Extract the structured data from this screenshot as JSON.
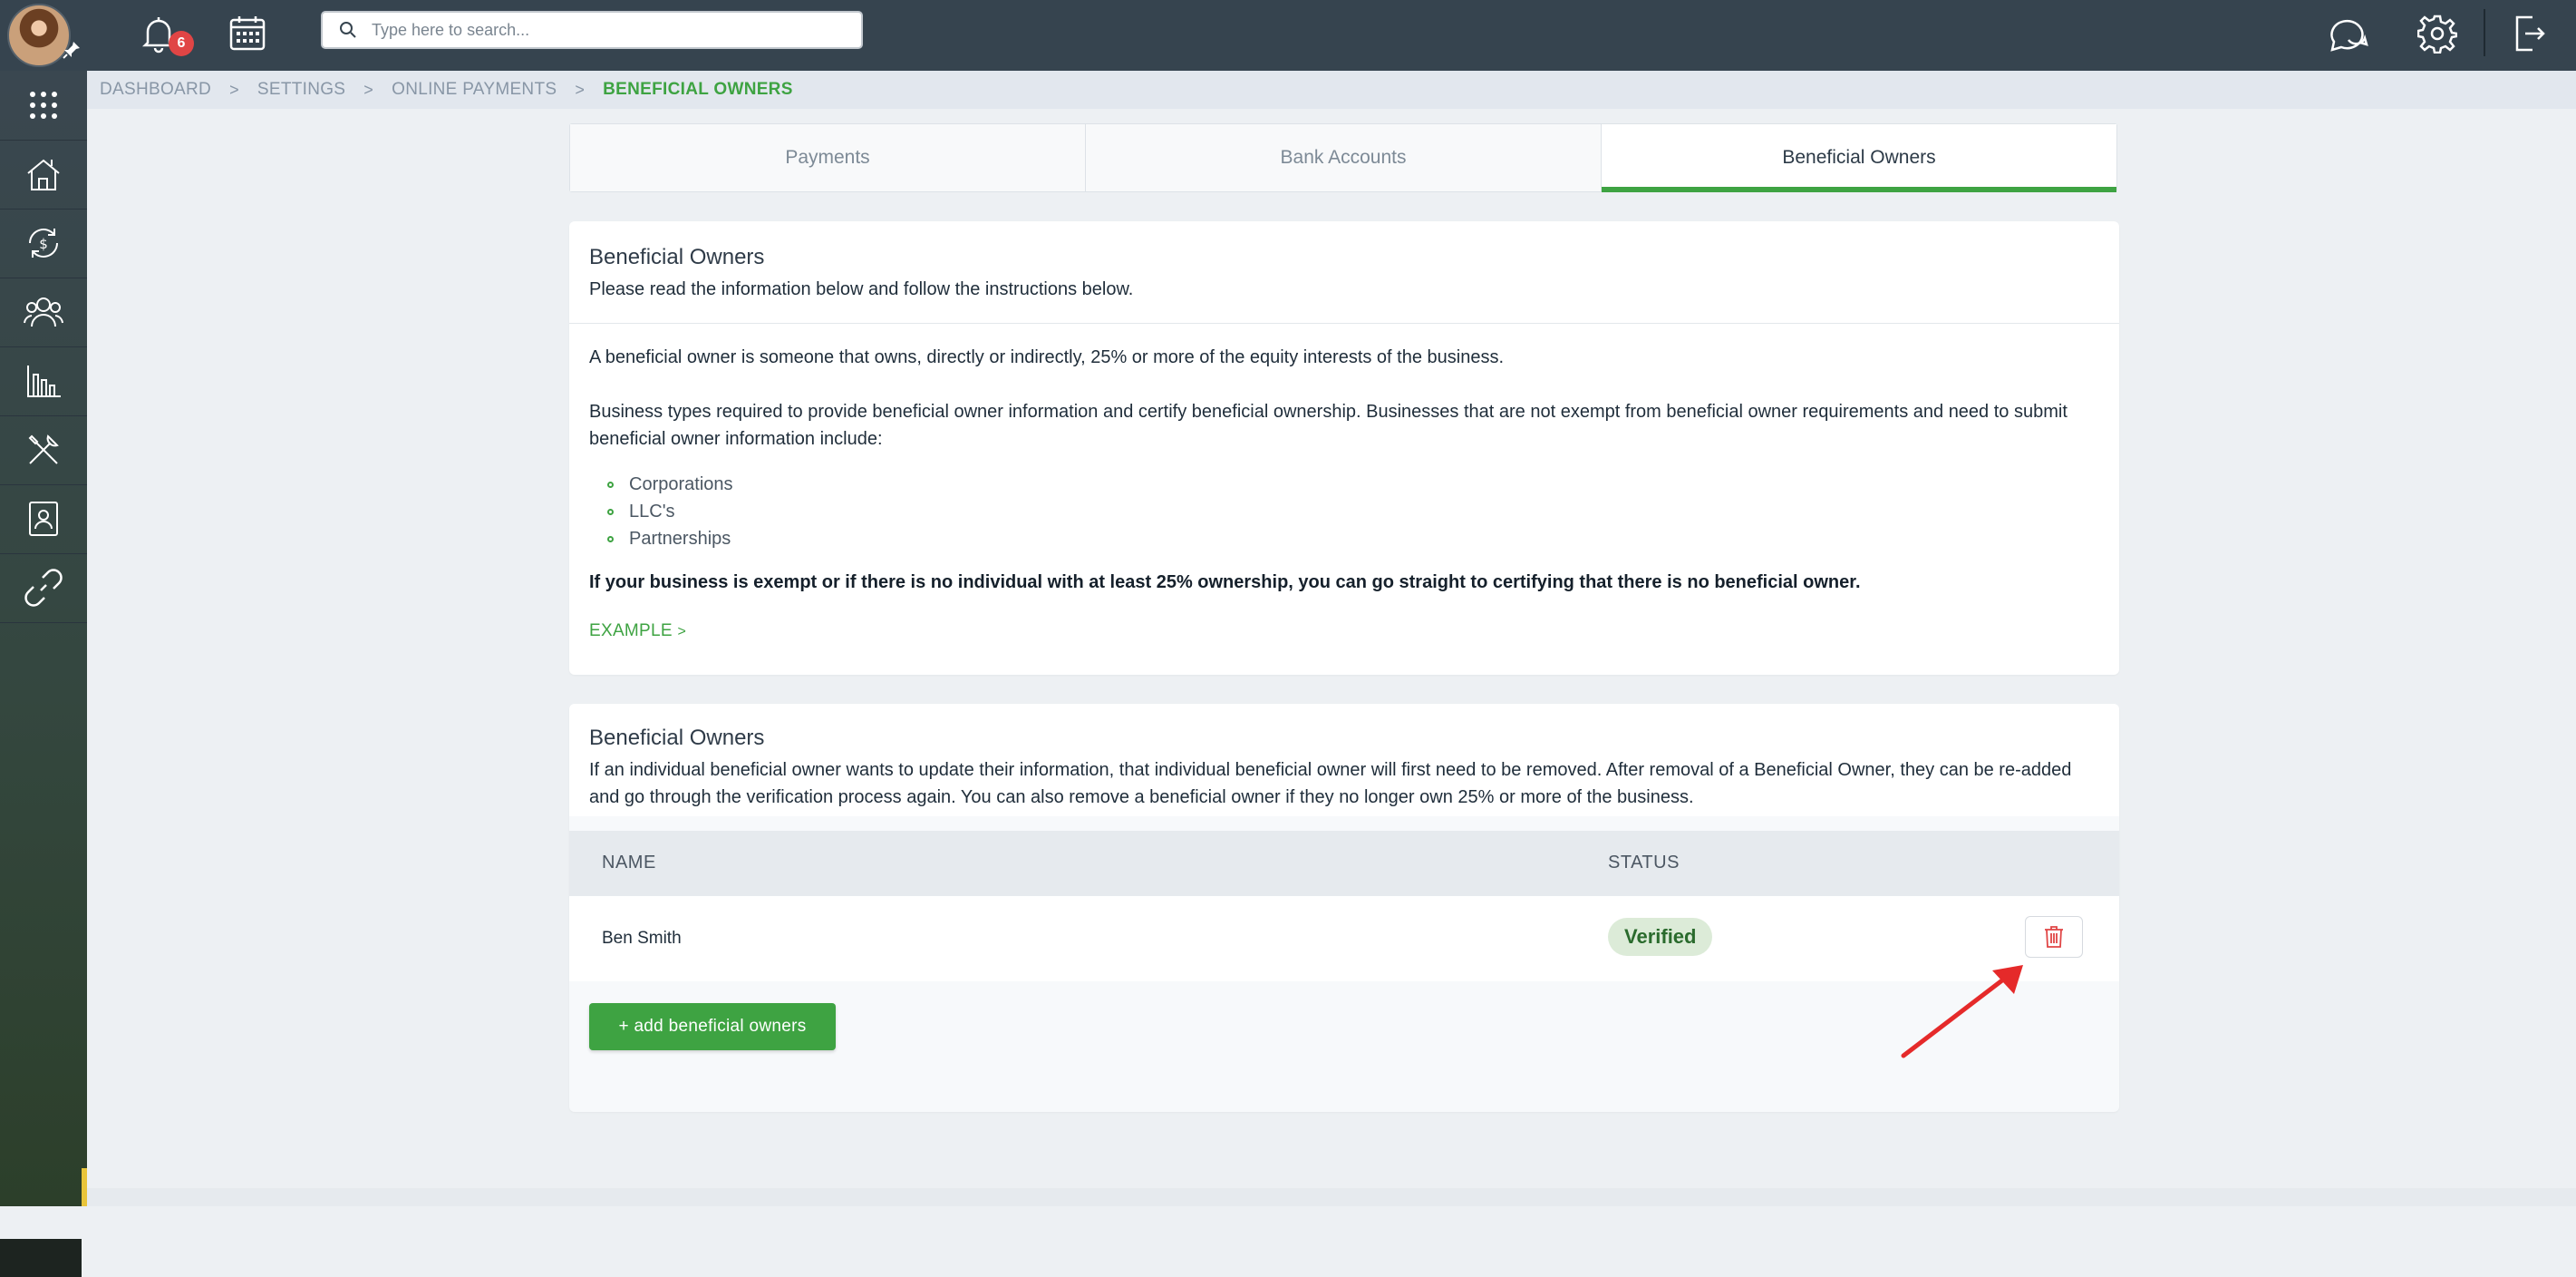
{
  "topbar": {
    "notification_count": "6",
    "search_placeholder": "Type here to search..."
  },
  "icons": {
    "bell": "bell-icon",
    "calendar": "calendar-icon",
    "search": "search-icon",
    "chat": "chat-icon",
    "settings": "gear-icon",
    "logout": "logout-icon"
  },
  "sidebar": {
    "items": [
      "apps-grid-icon",
      "home-icon",
      "payments-cycle-icon",
      "people-icon",
      "reports-chart-icon",
      "tools-icon",
      "contacts-card-icon",
      "link-icon"
    ]
  },
  "breadcrumb": {
    "items": [
      "DASHBOARD",
      "SETTINGS",
      "ONLINE PAYMENTS",
      "BENEFICIAL OWNERS"
    ],
    "separator": ">"
  },
  "tabs": [
    {
      "label": "Payments"
    },
    {
      "label": "Bank Accounts"
    },
    {
      "label": "Beneficial Owners"
    }
  ],
  "info_card": {
    "title": "Beneficial Owners",
    "subtitle": "Please read the information below and follow the instructions below.",
    "paragraph1": "A beneficial owner is someone that owns, directly or indirectly, 25% or more of the equity interests of the business.",
    "paragraph2": "Business types required to provide beneficial owner information and certify beneficial ownership. Businesses that are not exempt from beneficial owner requirements and need to submit beneficial owner information include:",
    "business_types": [
      "Corporations",
      "LLC's",
      "Partnerships"
    ],
    "note": "If your business is exempt or if there is no individual with at least 25% ownership, you can go straight to certifying that there is no beneficial owner.",
    "example_link": "EXAMPLE",
    "example_chevron": ">"
  },
  "owners_card": {
    "title": "Beneficial Owners",
    "description": "If an individual beneficial owner wants to update their information, that individual beneficial owner will first need to be removed. After removal of a Beneficial Owner, they can be re-added and go through the verification process again. You can also remove a beneficial owner if they no longer own 25% or more of the business.",
    "columns": {
      "name": "NAME",
      "status": "STATUS"
    },
    "rows": [
      {
        "name": "Ben Smith",
        "status": "Verified"
      }
    ],
    "add_button": "+ add beneficial owners"
  },
  "colors": {
    "accent": "#3ea342",
    "topbar": "#36444f",
    "danger": "#e04545"
  }
}
